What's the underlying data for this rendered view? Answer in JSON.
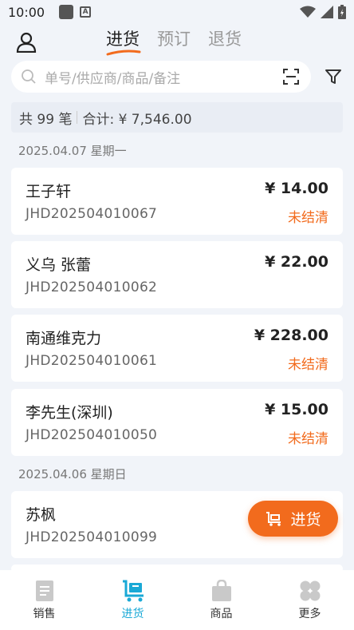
{
  "status_bar": {
    "time": "10:00"
  },
  "header": {
    "tabs": [
      {
        "label": "进货",
        "active": true
      },
      {
        "label": "预订",
        "active": false
      },
      {
        "label": "退货",
        "active": false
      }
    ]
  },
  "search": {
    "placeholder": "单号/供应商/商品/备注"
  },
  "summary": {
    "count": "共 99 笔",
    "total": "合计: ¥ 7,546.00"
  },
  "groups": [
    {
      "date": "2025.04.07 星期一",
      "orders": [
        {
          "name": "王子轩",
          "number": "JHD202504010067",
          "amount": "¥ 14.00",
          "status": "未结清"
        },
        {
          "name": "义乌 张蕾",
          "number": "JHD202504010062",
          "amount": "¥ 22.00",
          "status": ""
        },
        {
          "name": "南通维克力",
          "number": "JHD202504010061",
          "amount": "¥ 228.00",
          "status": "未结清"
        },
        {
          "name": "李先生(深圳)",
          "number": "JHD202504010050",
          "amount": "¥ 15.00",
          "status": "未结清"
        }
      ]
    },
    {
      "date": "2025.04.06 星期日",
      "orders": [
        {
          "name": "苏枫",
          "number": "JHD202504010099",
          "amount": "",
          "status": ""
        }
      ]
    }
  ],
  "fab": {
    "label": "进货"
  },
  "bottom_nav": [
    {
      "label": "销售",
      "icon": "document-icon",
      "active": false
    },
    {
      "label": "进货",
      "icon": "cart-icon",
      "active": true
    },
    {
      "label": "商品",
      "icon": "bag-icon",
      "active": false
    },
    {
      "label": "更多",
      "icon": "clover-icon",
      "active": false
    }
  ],
  "colors": {
    "accent": "#f26b1d",
    "nav_active": "#1aa9d6",
    "background": "#f1f4f9"
  }
}
